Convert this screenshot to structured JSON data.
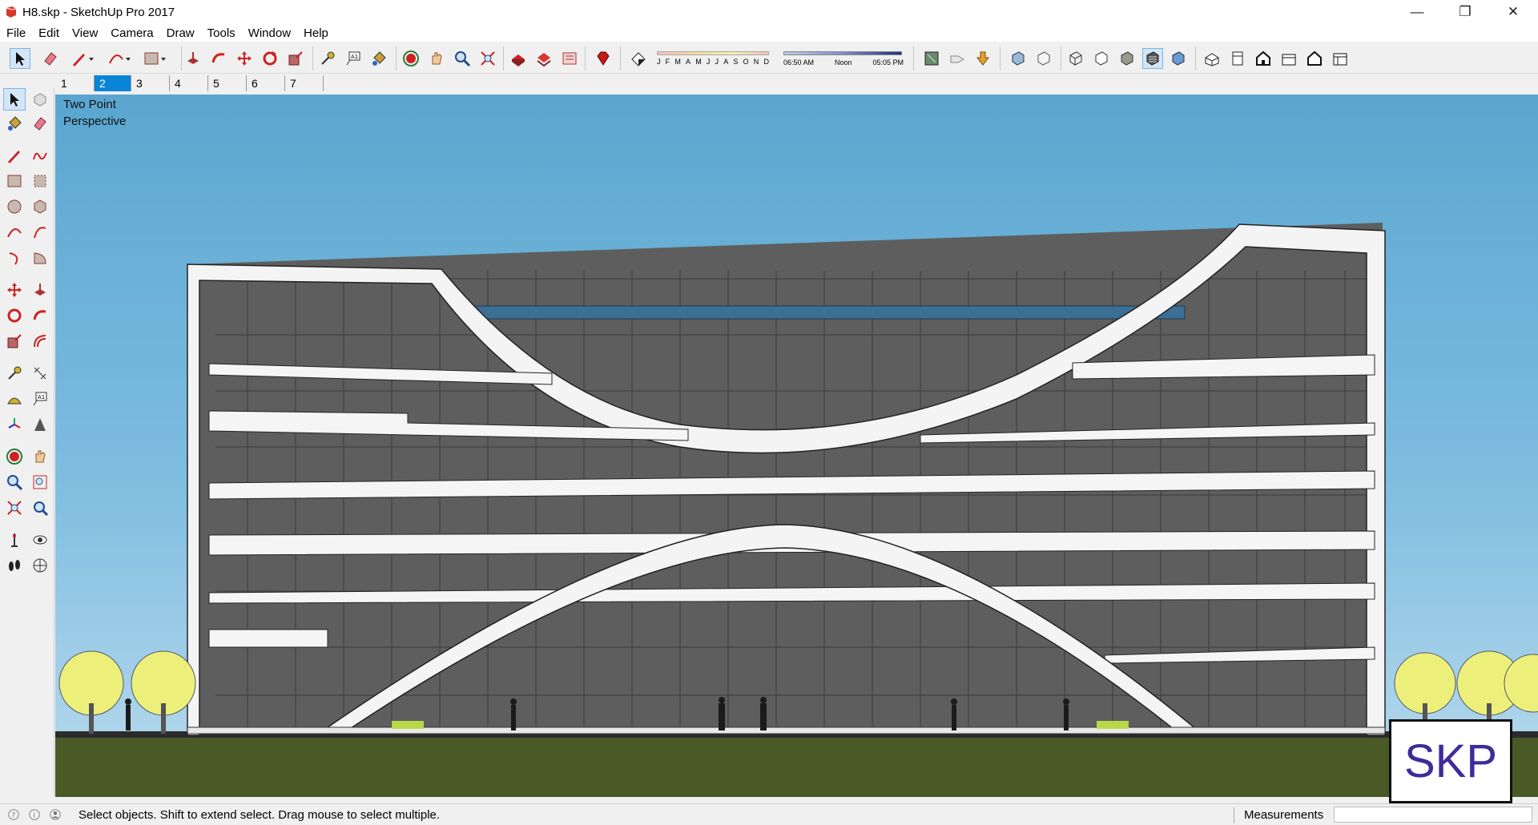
{
  "window": {
    "title": "H8.skp - SketchUp Pro 2017",
    "controls": {
      "minimize": "—",
      "maximize": "❐",
      "close": "✕"
    }
  },
  "menu": [
    "File",
    "Edit",
    "View",
    "Camera",
    "Draw",
    "Tools",
    "Window",
    "Help"
  ],
  "shadow_settings": {
    "months": [
      "J",
      "F",
      "M",
      "A",
      "M",
      "J",
      "J",
      "A",
      "S",
      "O",
      "N",
      "D"
    ],
    "time_start": "06:50 AM",
    "time_mid": "Noon",
    "time_end": "05:05 PM"
  },
  "scene_tabs": [
    "1",
    "2",
    "3",
    "4",
    "5",
    "6",
    "7"
  ],
  "active_scene_tab": "2",
  "viewport": {
    "camera_label_line1": "Two Point",
    "camera_label_line2": "Perspective"
  },
  "badge": "SKP",
  "status": {
    "text": "Select objects. Shift to extend select. Drag mouse to select multiple.",
    "measurements_label": "Measurements",
    "measurements_value": ""
  },
  "colors": {
    "sky_top": "#5aa6d0",
    "ground": "#4a5a26",
    "building_frame": "#f4f4f4",
    "building_glass": "#5c5c5c",
    "active_tab": "#0a84d6",
    "badge_text": "#3f2b9a"
  },
  "icons": {
    "toolbar": [
      "select-icon",
      "eraser-icon",
      "pencil-icon",
      "arc-icon",
      "rectangle-icon",
      "push-pull-icon",
      "follow-me-icon",
      "move-icon",
      "rotate-icon",
      "scale-icon",
      "tape-measure-icon",
      "text-icon",
      "paint-bucket-icon",
      "orbit-icon",
      "pan-icon",
      "zoom-icon",
      "zoom-extents-icon",
      "warehouse-icon",
      "extension-warehouse-icon",
      "send-to-layout-icon",
      "ruby-icon",
      "shadow-icon",
      "xray-icon",
      "back-edges-icon",
      "wireframe-icon",
      "hidden-line-icon",
      "shaded-icon",
      "textured-icon",
      "monochrome-icon",
      "iso-icon",
      "top-view-icon",
      "front-view-icon",
      "right-view-icon",
      "back-view-icon",
      "left-view-icon"
    ]
  }
}
